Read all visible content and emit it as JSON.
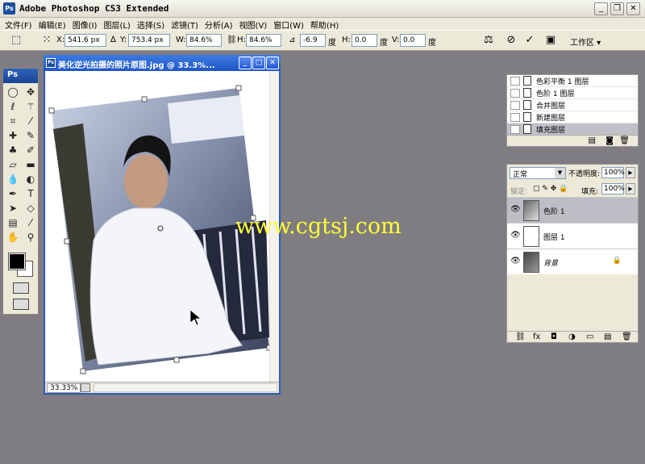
{
  "app": {
    "title": "Adobe Photoshop CS3 Extended",
    "logo": "Ps",
    "controls": [
      "_",
      "❐",
      "✕"
    ]
  },
  "menu": [
    "文件(F)",
    "编辑(E)",
    "图像(I)",
    "图层(L)",
    "选择(S)",
    "滤镜(T)",
    "分析(A)",
    "视图(V)",
    "窗口(W)",
    "帮助(H)"
  ],
  "options": {
    "x_label": "X:",
    "x": "541.6 px",
    "y_label": "Y:",
    "y": "753.4 px",
    "w_label": "W:",
    "w": "84.6%",
    "h_label": "H:",
    "h": "84.6%",
    "angle": "-6.9",
    "angle_unit": "度",
    "hskew_label": "H:",
    "hskew": "0.0",
    "hskew_unit": "度",
    "vskew_label": "V:",
    "vskew": "0.0",
    "vskew_unit": "度",
    "workspace": "工作区 ▾"
  },
  "toolbox": {
    "title": "Ps"
  },
  "document": {
    "title": "美化逆光拍摄的照片原图.jpg @ 33.3%...",
    "zoom": "33.33%",
    "watermark": "www.cgtsj.com"
  },
  "history": {
    "items": [
      {
        "label": "色彩平衡 1 图层",
        "selected": false
      },
      {
        "label": "色阶 1 图层",
        "selected": false
      },
      {
        "label": "合并图层",
        "selected": false
      },
      {
        "label": "新建图层",
        "selected": false
      },
      {
        "label": "填充图层",
        "selected": true
      }
    ]
  },
  "layers": {
    "blend_mode": "正常",
    "opacity_label": "不透明度:",
    "opacity": "100%",
    "lock_label": "锁定:",
    "fill_label": "填充:",
    "fill": "100%",
    "items": [
      {
        "name": "色阶 1",
        "selected": true,
        "locked": false
      },
      {
        "name": "图层 1",
        "selected": false,
        "locked": false
      },
      {
        "name": "背景",
        "selected": false,
        "locked": true
      }
    ]
  },
  "colors": {
    "accent": "#2a5bb9",
    "workspace_bg": "#7f7d82",
    "watermark": "#ffff33"
  }
}
